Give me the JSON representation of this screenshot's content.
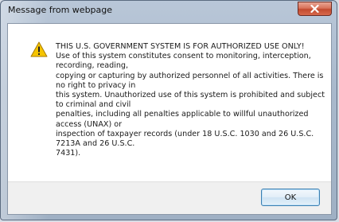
{
  "window": {
    "title": "Message from webpage"
  },
  "dialog": {
    "icon": "warning-icon",
    "message_lines": [
      "THIS U.S. GOVERNMENT SYSTEM IS FOR AUTHORIZED USE ONLY!",
      "Use of this system constitutes consent to monitoring, interception,",
      "recording, reading,",
      "copying or capturing by authorized personnel of all activities.  There is",
      "no right to privacy in",
      "this system.  Unauthorized use of this system is prohibited and subject",
      "to criminal and civil",
      "penalties, including all penalties applicable to willful unauthorized",
      "access (UNAX) or",
      "inspection of taxpayer records (under 18 U.S.C. 1030 and 26 U.S.C.",
      "7213A and 26 U.S.C.",
      "7431)."
    ],
    "ok_label": "OK"
  },
  "colors": {
    "close_button": "#c24a2f",
    "ok_border": "#3c7fb1",
    "warning_fill": "#f5c400"
  }
}
